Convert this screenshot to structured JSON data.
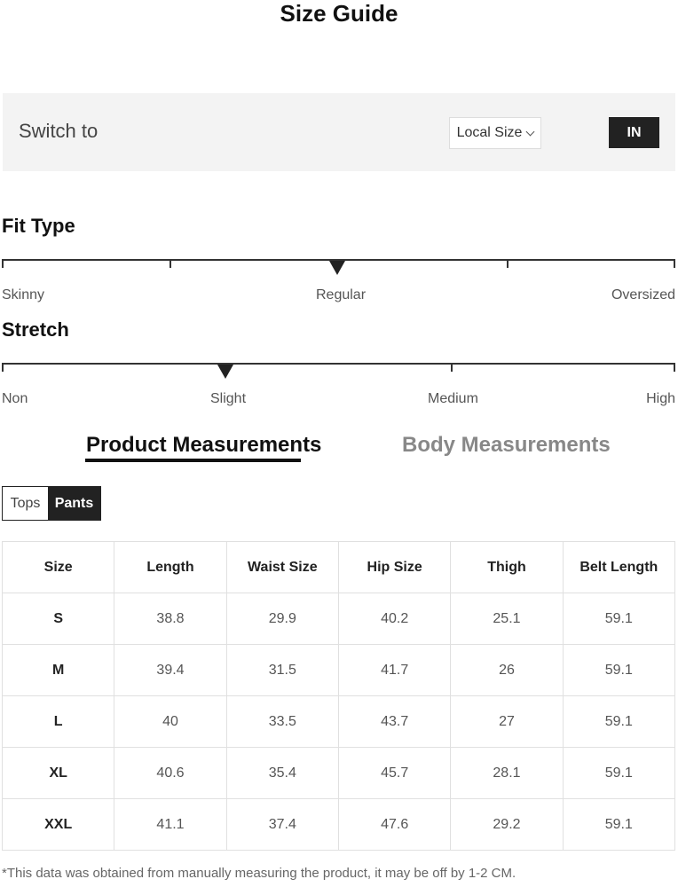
{
  "title": "Size Guide",
  "switch": {
    "label": "Switch to",
    "local_size_label": "Local Size",
    "unit_label": "IN"
  },
  "fit_type": {
    "heading": "Fit Type",
    "labels": [
      "Skinny",
      "Regular",
      "Oversized"
    ],
    "selected_index": 1
  },
  "stretch": {
    "heading": "Stretch",
    "labels": [
      "Non",
      "Slight",
      "Medium",
      "High"
    ],
    "selected_index": 1
  },
  "tabs": {
    "product": "Product Measurements",
    "body": "Body Measurements"
  },
  "segment": {
    "tops": "Tops",
    "pants": "Pants"
  },
  "table": {
    "headers": [
      "Size",
      "Length",
      "Waist Size",
      "Hip Size",
      "Thigh",
      "Belt Length"
    ],
    "rows": [
      [
        "S",
        "38.8",
        "29.9",
        "40.2",
        "25.1",
        "59.1"
      ],
      [
        "M",
        "39.4",
        "31.5",
        "41.7",
        "26",
        "59.1"
      ],
      [
        "L",
        "40",
        "33.5",
        "43.7",
        "27",
        "59.1"
      ],
      [
        "XL",
        "40.6",
        "35.4",
        "45.7",
        "28.1",
        "59.1"
      ],
      [
        "XXL",
        "41.1",
        "37.4",
        "47.6",
        "29.2",
        "59.1"
      ]
    ]
  },
  "footnote": "*This data was obtained from manually measuring the product, it may be off by 1-2 CM.",
  "colors": {
    "accent": "#222222",
    "panel_bg": "#f3f3f3",
    "muted_text": "#888888"
  }
}
